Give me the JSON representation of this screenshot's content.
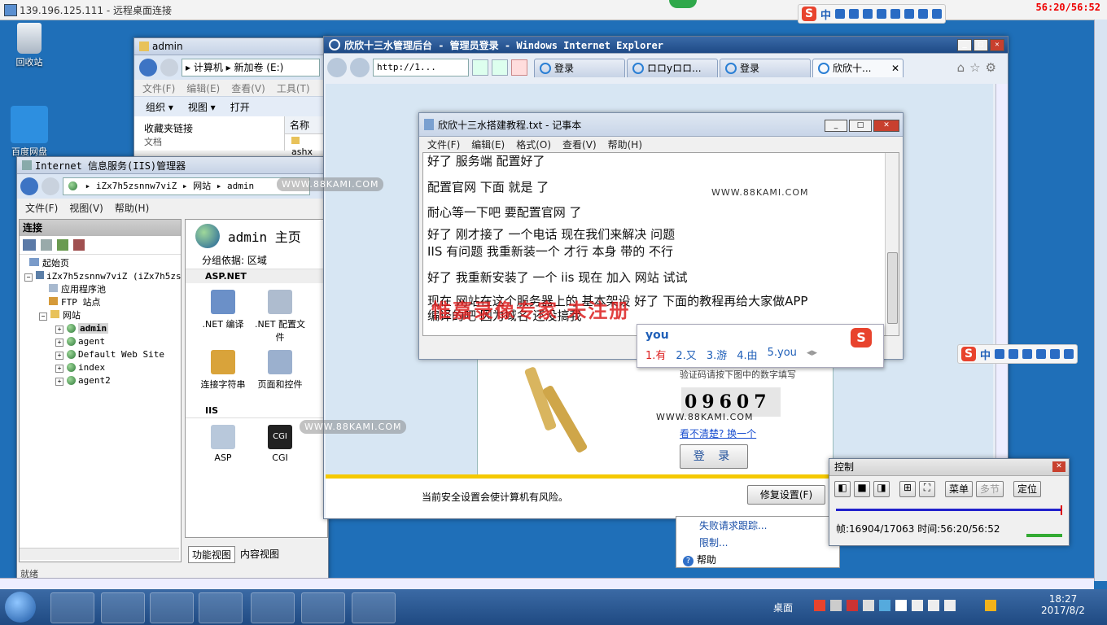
{
  "remote_desktop": {
    "title": "139.196.125.111 - 远程桌面连接",
    "timer": "56:20/56:52"
  },
  "ime_bar": {
    "logo": "S",
    "mode": "中"
  },
  "desktop": {
    "icons": [
      {
        "label": "回收站"
      },
      {
        "label": "百度网盘"
      }
    ]
  },
  "explorer": {
    "title": "admin",
    "path": "▸ 计算机 ▸ 新加卷 (E:)",
    "menu": [
      "文件(F)",
      "编辑(E)",
      "查看(V)",
      "工具(T)"
    ],
    "toolbar": [
      "组织 ▾",
      "视图 ▾",
      "打开"
    ],
    "left_header": "收藏夹链接",
    "col_name": "名称",
    "file": "ashx",
    "left_item": "文档"
  },
  "iis": {
    "title": "Internet 信息服务(IIS)管理器",
    "address": [
      "iZx7h5zsnnw7viZ",
      "网站",
      "admin"
    ],
    "menu": [
      "文件(F)",
      "视图(V)",
      "帮助(H)"
    ],
    "connections_header": "连接",
    "tree": [
      {
        "label": "起始页",
        "level": 1
      },
      {
        "label": "iZx7h5zsnnw7viZ (iZx7h5zsn",
        "level": 1
      },
      {
        "label": "应用程序池",
        "level": 2
      },
      {
        "label": "FTP 站点",
        "level": 2
      },
      {
        "label": "网站",
        "level": 2
      },
      {
        "label": "admin",
        "level": 3
      },
      {
        "label": "agent",
        "level": 3
      },
      {
        "label": "Default Web Site",
        "level": 3
      },
      {
        "label": "index",
        "level": 3
      },
      {
        "label": "agent2",
        "level": 3
      }
    ],
    "home_title": "admin 主页",
    "group_by_label": "分组依据:",
    "group_by_value": "区域",
    "sec_aspnet": "ASP.NET",
    "features_aspnet": [
      ".NET 编译",
      ".NET 配置文件",
      "连接字符串",
      "页面和控件"
    ],
    "sec_iis": "IIS",
    "features_iis": [
      "ASP",
      "CGI"
    ],
    "view_tabs": [
      "功能视图",
      "内容视图"
    ],
    "status": "就绪"
  },
  "ie": {
    "title": "欣欣十三水管理后台 - 管理员登录 - Windows Internet Explorer",
    "address": "http://1...",
    "tabs": [
      "登录",
      "ロロyロロ...",
      "登录",
      "欣欣十..."
    ],
    "captcha_hint": "验证码请按下图中的数字填写",
    "captcha": "09607",
    "refresh_link": "看不清楚? 换一个",
    "login_btn": "登 录",
    "security_bar": "当前安全设置会使计算机有风险。",
    "fix_btn": "修复设置(F)",
    "side_links": [
      "失败请求跟踪...",
      "限制...",
      "帮助"
    ]
  },
  "notepad": {
    "title": "欣欣十三水搭建教程.txt - 记事本",
    "menu": [
      "文件(F)",
      "编辑(E)",
      "格式(O)",
      "查看(V)",
      "帮助(H)"
    ],
    "lines": [
      "好了   服务端 配置好了",
      "配置官网      下面   就是   了",
      "耐心等一下吧   要配置官网   了",
      "好了    刚才接了 一个电话    现在我们来解决 问题",
      "IIS     有问题    我重新装一个       才行    本身   带的 不行",
      "好了 我重新安装了 一个 iis    现在  加入 网站 试试",
      "现在 网站在这个服务器上的    基本架设 好了      下面的教程再给大家做APP",
      "编译的吧     因为域名  还没搞我"
    ]
  },
  "watermark": {
    "text": "WWW.88KAMI.COM",
    "red_overlay": "惟嘉录像专家 未注册"
  },
  "ime_popup": {
    "input": "you",
    "candidates": [
      "1.有",
      "2.又",
      "3.游",
      "4.由",
      "5.you"
    ]
  },
  "player": {
    "title": "控制",
    "menu_btn": "菜单",
    "step_btn": "多节",
    "locate_btn": "定位",
    "status": "帧:16904/17063 时间:56:20/56:52"
  },
  "taskbar": {
    "desktop_label": "桌面",
    "time": "18:27",
    "date": "2017/8/2"
  }
}
